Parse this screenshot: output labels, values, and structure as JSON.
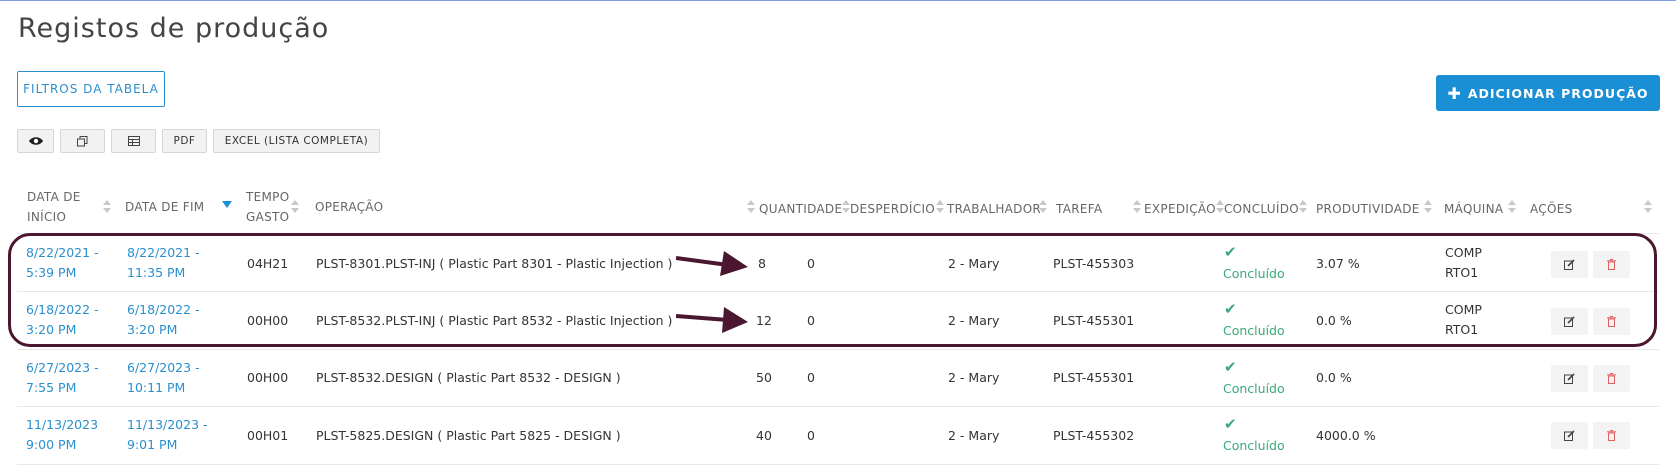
{
  "page": {
    "title": "Registos de produção"
  },
  "actions": {
    "filters_label": "FILTROS DA TABELA",
    "add_label": "ADICIONAR PRODUÇÃO",
    "add_icon": "plus-icon"
  },
  "toolbar": {
    "view_icon": "eye-icon",
    "copy_icon": "copy-icon",
    "table_icon": "table-icon",
    "pdf_label": "PDF",
    "excel_label": "EXCEL (LISTA COMPLETA)"
  },
  "columns": {
    "start_date_1": "DATA DE",
    "start_date_2": "INÍCIO",
    "end_date": "DATA DE FIM",
    "time_1": "TEMPO",
    "time_2": "GASTO",
    "operation": "OPERAÇÃO",
    "quantity": "QUANTIDADE",
    "waste": "DESPERDÍCIO",
    "worker": "TRABALHADOR",
    "task": "TAREFA",
    "shipping": "EXPEDIÇÃO",
    "completed": "CONCLUÍDO",
    "productivity": "PRODUTIVIDADE",
    "machine": "MÁQUINA",
    "actions": "AÇÕES"
  },
  "rows": [
    {
      "start_1": "8/22/2021 -",
      "start_2": "5:39 PM",
      "end_1": "8/22/2021 -",
      "end_2": "11:35 PM",
      "time": "04H21",
      "operation": "PLST-8301.PLST-INJ ( Plastic Part 8301 - Plastic Injection )",
      "quantity": "8",
      "waste": "0",
      "worker": "2 - Mary",
      "task": "PLST-455303",
      "completed": "Concluído",
      "productivity": "3.07 %",
      "machine_1": "COMP",
      "machine_2": "RTO1"
    },
    {
      "start_1": "6/18/2022 -",
      "start_2": "3:20 PM",
      "end_1": "6/18/2022 -",
      "end_2": "3:20 PM",
      "time": "00H00",
      "operation": "PLST-8532.PLST-INJ ( Plastic Part 8532 - Plastic Injection )",
      "quantity": "12",
      "waste": "0",
      "worker": "2 - Mary",
      "task": "PLST-455301",
      "completed": "Concluído",
      "productivity": "0.0 %",
      "machine_1": "COMP",
      "machine_2": "RTO1"
    },
    {
      "start_1": "6/27/2023 -",
      "start_2": "7:55 PM",
      "end_1": "6/27/2023 -",
      "end_2": "10:11 PM",
      "time": "00H00",
      "operation": "PLST-8532.DESIGN ( Plastic Part 8532 - DESIGN )",
      "quantity": "50",
      "waste": "0",
      "worker": "2 - Mary",
      "task": "PLST-455301",
      "completed": "Concluído",
      "productivity": "0.0 %",
      "machine_1": "",
      "machine_2": ""
    },
    {
      "start_1": "11/13/2023",
      "start_2": "9:00 PM",
      "end_1": "11/13/2023 -",
      "end_2": "9:01 PM",
      "time": "00H01",
      "operation": "PLST-5825.DESIGN ( Plastic Part 5825 - DESIGN )",
      "quantity": "40",
      "waste": "0",
      "worker": "2 - Mary",
      "task": "PLST-455302",
      "completed": "Concluído",
      "productivity": "4000.0 %",
      "machine_1": "",
      "machine_2": ""
    }
  ],
  "row_icons": {
    "edit": "edit-icon",
    "delete": "trash-icon",
    "completed": "check-icon"
  },
  "annotation": {
    "color": "#4a1630",
    "arrow_icon": "arrow-right-icon"
  },
  "colors": {
    "accent": "#1a8fd6",
    "link": "#2a8fcf",
    "success": "#3aa87a",
    "delete": "#e06060"
  }
}
